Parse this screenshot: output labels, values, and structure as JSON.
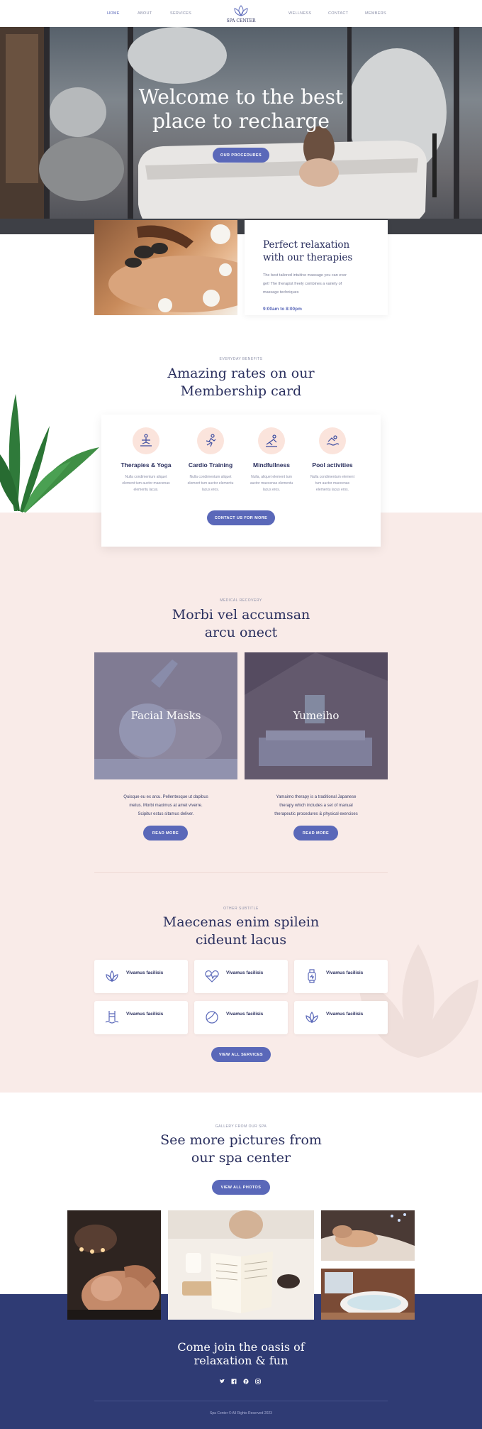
{
  "nav": {
    "left": [
      "HOME",
      "ABOUT",
      "SERVICES"
    ],
    "right": [
      "WELLNESS",
      "CONTACT",
      "MEMBERS"
    ],
    "logo": "SPA CENTER"
  },
  "hero": {
    "title_line1": "Welcome to the best",
    "title_line2": "place to recharge",
    "button": "OUR PROCEDURES"
  },
  "intro": {
    "title_line1": "Perfect relaxation",
    "title_line2": "with our therapies",
    "desc_line1": "The best tailored intuitive massage you can ever",
    "desc_line2": "get! The therapist freely combines a variety of",
    "desc_line3": "massage techniques",
    "hours": "9:00am to 8:00pm"
  },
  "membership": {
    "eyebrow": "EVERYDAY BENEFITS",
    "title_line1": "Amazing rates on our",
    "title_line2": "Membership card",
    "features": [
      {
        "title": "Therapies & Yoga",
        "d1": "Nulla condimentum aliquet",
        "d2": "element tum auctor maecenas",
        "d3": "elementu lacus.",
        "icon": "yoga-icon"
      },
      {
        "title": "Cardio Training",
        "d1": "Nulla condimentum aliquet",
        "d2": "element tum auctor elementu",
        "d3": "lacus eros.",
        "icon": "running-icon"
      },
      {
        "title": "Mindfullness",
        "d1": "Nulla, aliquet element tum",
        "d2": "auctor maecenas elementu",
        "d3": "lacus eros.",
        "icon": "meditation-icon"
      },
      {
        "title": "Pool activities",
        "d1": "Nulla condimentum element",
        "d2": "tum auctor maecenas",
        "d3": "elementu lacus eros.",
        "icon": "swimming-icon"
      }
    ],
    "button": "CONTACT US FOR MORE"
  },
  "recovery": {
    "eyebrow": "MEDICAL RECOVERY",
    "title_line1": "Morbi vel accumsan",
    "title_line2": "arcu onect",
    "cards": [
      {
        "title": "Facial Masks",
        "d1": "Quisque eu ex arcu. Pellentesque ut dapibus",
        "d2": "metus. Morbi maximus at amet viverre.",
        "d3": "Scipitur estus sitamus deliver.",
        "button": "READ MORE"
      },
      {
        "title": "Yumeiho",
        "d1": "Yamaimo therapy is a traditional Japanese",
        "d2": "therapy which includes a set of manual",
        "d3": "therapeutic procedures & physical exercises",
        "button": "READ MORE"
      }
    ]
  },
  "services": {
    "eyebrow": "OTHER SUBTITLE",
    "title_line1": "Maecenas enim spilein",
    "title_line2": "cideunt lacus",
    "items": [
      {
        "label": "Vivamus facilisis",
        "icon": "lotus-icon"
      },
      {
        "label": "Vivamus facilisis",
        "icon": "heart-pulse-icon"
      },
      {
        "label": "Vivamus facilisis",
        "icon": "smartwatch-icon"
      },
      {
        "label": "Vivamus facilisis",
        "icon": "pool-ladder-icon"
      },
      {
        "label": "Vivamus facilisis",
        "icon": "ball-icon"
      },
      {
        "label": "Vivamus facilisis",
        "icon": "lotus-icon"
      }
    ],
    "button": "VIEW ALL SERVICES"
  },
  "gallery": {
    "eyebrow": "GALLERY FROM OUR SPA",
    "title_line1": "See more pictures from",
    "title_line2": "our spa center",
    "button": "VIEW ALL PHOTOS"
  },
  "footer": {
    "title_line1": "Come join the oasis of",
    "title_line2": "relaxation & fun",
    "social": [
      "twitter-icon",
      "facebook-icon",
      "pinterest-icon",
      "instagram-icon"
    ],
    "copyright": "Spa Center © All Rights Reserved 2023"
  },
  "colors": {
    "accent": "#5a68b9",
    "navy": "#2a2f5e",
    "pink": "#f9ebe8",
    "footer": "#2f3b74"
  }
}
